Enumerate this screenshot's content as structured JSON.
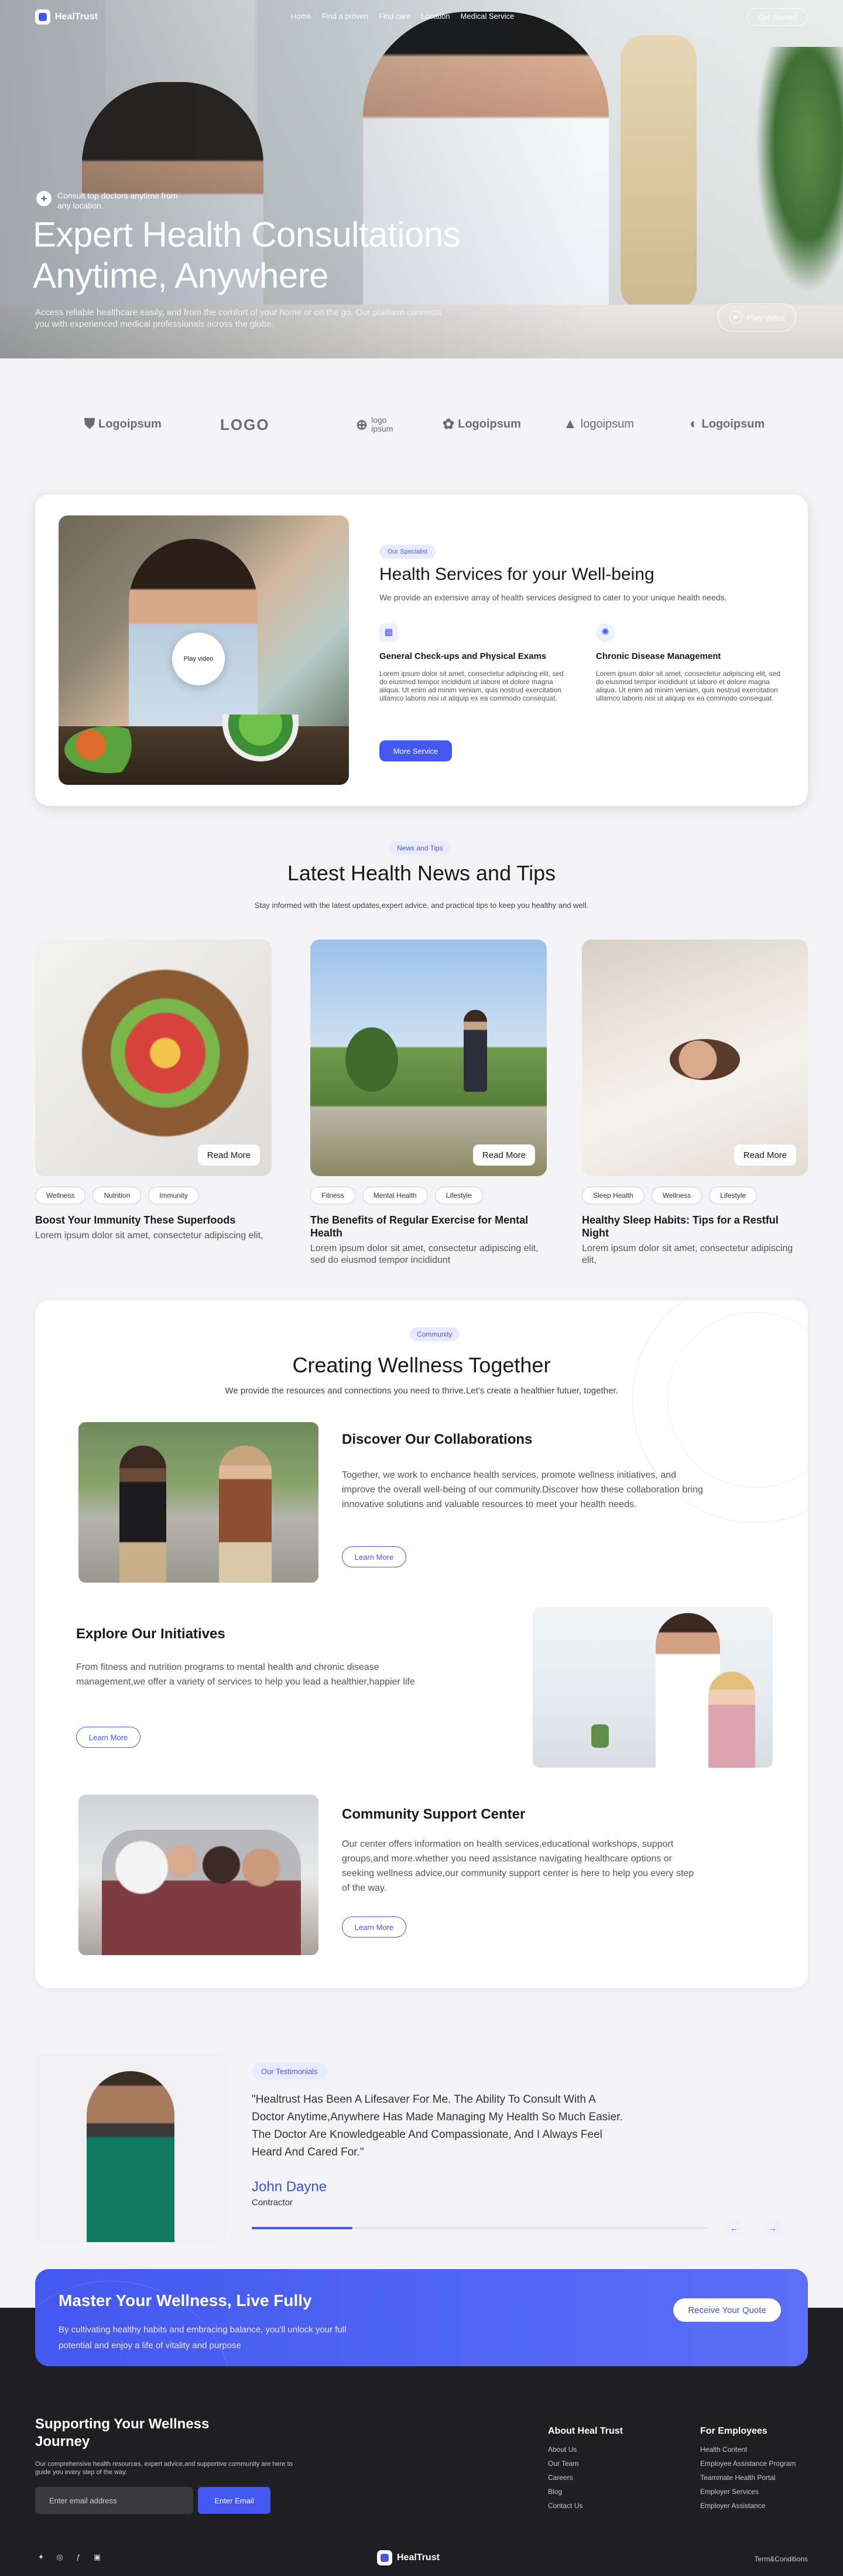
{
  "brand": {
    "name": "HealTrust"
  },
  "nav": {
    "links": [
      "Home",
      "Find a proven",
      "Find care",
      "Location",
      "Medical Service"
    ],
    "cta": "Get Started"
  },
  "hero": {
    "badge": "Consult top doctors anytime from any location.",
    "title_line1": "Expert Health Consultations",
    "title_line2": "Anytime, Anywhere",
    "subtitle": "Access reliable healthcare easily, and from the comfort of your home or on the go. Our platform connects you with experienced medical professionals across the globe.",
    "play_label": "Play video"
  },
  "logos": [
    "Logoipsum",
    "LOGO",
    "logo ipsum",
    "Logoipsum",
    "logoipsum",
    "Logoipsum"
  ],
  "services": {
    "pill": "Our Specialist",
    "title": "Health Services for your Well-being",
    "desc": "We provide an extensive array of health services designed to cater to your unique health needs.",
    "play_label": "Play video",
    "items": [
      {
        "title": "General Check-ups and Physical Exams",
        "text": "Lorem ipsum dolor sit amet, consectetur adipiscing elit, sed do eiusmod tempor incididunt ut labore et dolore magna aliqua. Ut enim ad minim veniam, quis nostrud exercitation ullamco laboris nisi ut aliquip ex ea commodo consequat."
      },
      {
        "title": "Chronic Disease Management",
        "text": "Lorem ipsum dolor sit amet, consectetur adipiscing elit, sed do eiusmod tempor incididunt ut labore et dolore magna aliqua. Ut enim ad minim veniam, quis nostrud exercitation ullamco laboris nisi ut aliquip ex ea commodo consequat."
      }
    ],
    "button": "More Service"
  },
  "news": {
    "pill": "News and Tips",
    "title": "Latest Health News and Tips",
    "subtitle": "Stay informed with the latest updates,expert advice, and practical tips to keep you healthy and well.",
    "read_more": "Read More",
    "cards": [
      {
        "tags": [
          "Wellness",
          "Nutrition",
          "Immunity"
        ],
        "title": "Boost Your Immunity These Superfoods",
        "text": "Lorem ipsum dolor sit amet, consectetur adipiscing elit,"
      },
      {
        "tags": [
          "Fitness",
          "Mental Health",
          "Lifestyle"
        ],
        "title": "The Benefits of Regular Exercise for Mental Health",
        "text": "Lorem ipsum dolor sit amet, consectetur adipiscing elit, sed do eiusmod tempor incididunt"
      },
      {
        "tags": [
          "Sleep Health",
          "Wellness",
          "Lifestyle"
        ],
        "title": "Healthy Sleep Habits: Tips for a Restful Night",
        "text": "Lorem ipsum dolor sit amet, consectetur adipiscing elit,"
      }
    ]
  },
  "community": {
    "pill": "Community",
    "title": "Creating Wellness Together",
    "subtitle": "We provide the resources and connections you need to thrive.Let's create a healthier futuer, together.",
    "button": "Learn More",
    "blocks": [
      {
        "title": "Discover Our Collaborations",
        "text": "Together, we work to enchance health services, promote wellness initiatives, and improve the overall well-being of our community.Discover how these collaboration bring innovative solutions and valuable resources to meet your health needs."
      },
      {
        "title": "Explore Our Initiatives",
        "text": "From fitness and nutrition programs to mental health and chronic disease management,we offer a variety of services to help you lead a healthier,happier life"
      },
      {
        "title": "Community Support Center",
        "text": "Our  center offers information on health services,educational workshops, support groups,and more.whether you need assistance navigating healthcare options or seeking wellness advice,our community support center is here to help you every step of the way."
      }
    ]
  },
  "testimonial": {
    "pill": "Our Testimonials",
    "quote": "\"Healtrust Has Been A Lifesaver For Me. The Ability To Consult With A Doctor Anytime,Anywhere Has Made Managing My Health So Much Easier. The Doctor Are Knowledgeable And Compassionate, And I Always Feel Heard And Cared For.\"",
    "name": "John Dayne",
    "role": "Contractor",
    "progress": 0.22,
    "prev": "←",
    "next": "→"
  },
  "cta": {
    "title": "Master Your Wellness, Live Fully",
    "text": "By cultivating healthy habits and embracing balance, you'll unlock your full potential and enjoy a life of vitality and purpose",
    "button": "Receive Your Quote"
  },
  "footer": {
    "title": "Supporting Your Wellness Journey",
    "desc": "Our comprehensive health resources, expert advice,and supportive community are here to guide you every step of the way.",
    "email_placeholder": "Enter email address",
    "enter": "Enter Email",
    "col1": {
      "title": "About Heal Trust",
      "links": [
        "About Us",
        "Our Team",
        "Careers",
        "Blog",
        "Contact Us"
      ]
    },
    "col2": {
      "title": "For Employees",
      "links": [
        "Health Content",
        "Employee Assistance Program",
        "Teammate Health Portal",
        "Employer Services",
        "Employer Assistance"
      ]
    },
    "terms": "Term&Conditions"
  },
  "colors": {
    "accent": "#4458f0",
    "footer_bg": "#1f1f21"
  }
}
